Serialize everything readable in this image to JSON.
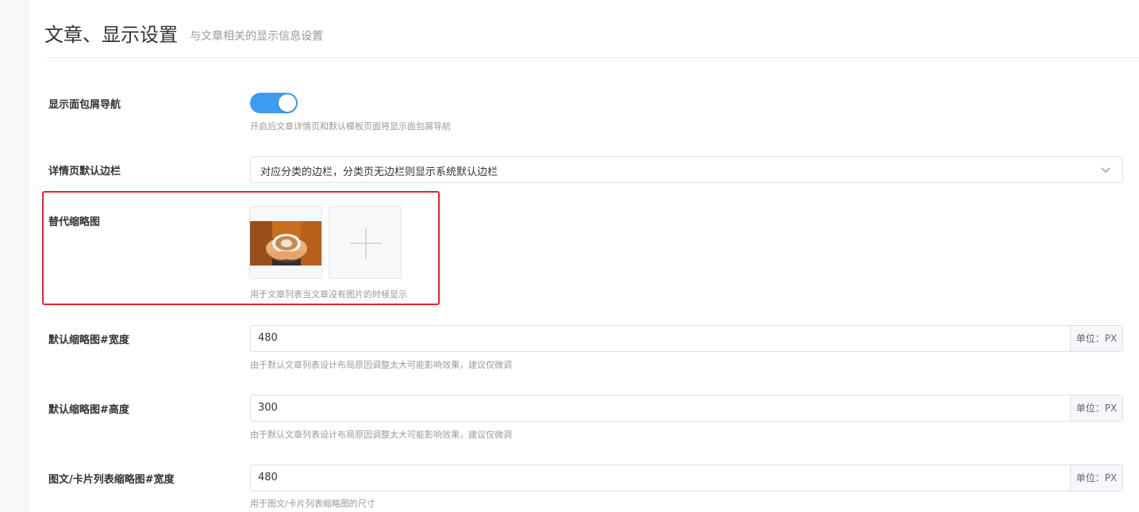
{
  "header": {
    "title": "文章、显示设置",
    "subtitle": "与文章相关的显示信息设置"
  },
  "settings": {
    "breadcrumb": {
      "label": "显示面包屑导航",
      "enabled": true,
      "hint": "开启后文章详情页和默认模板页面将显示面包屑导航"
    },
    "sidebar": {
      "label": "详情页默认边栏",
      "value": "对应分类的边栏，分类页无边栏则显示系统默认边栏"
    },
    "fallback_thumb": {
      "label": "替代缩略图",
      "hint": "用于文章列表当文章没有图片的时候显示"
    },
    "thumb_width": {
      "label": "默认缩略图#宽度",
      "value": "480",
      "unit": "单位：PX",
      "hint": "由于默认文章列表设计布局原因调整太大可能影响效果，建议仅微调"
    },
    "thumb_height": {
      "label": "默认缩略图#高度",
      "value": "300",
      "unit": "单位：PX",
      "hint": "由于默认文章列表设计布局原因调整太大可能影响效果，建议仅微调"
    },
    "card_thumb_width": {
      "label": "图文/卡片列表缩略图#宽度",
      "value": "480",
      "unit": "单位：PX",
      "hint": "用于图文/卡片列表缩略图的尺寸"
    }
  },
  "colors": {
    "accent": "#3d9cf0",
    "highlight": "#e8242a"
  }
}
